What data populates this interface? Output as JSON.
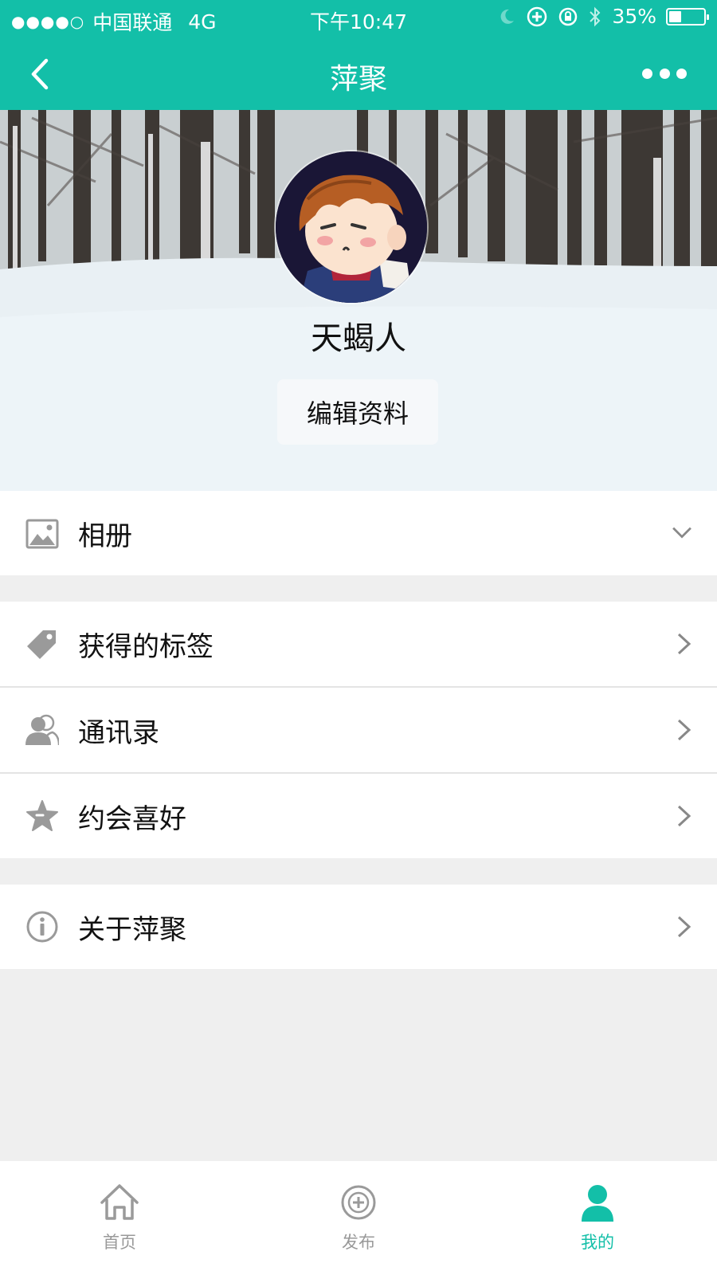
{
  "status_bar": {
    "signal_dots": "●●●●○",
    "carrier": "中国联通",
    "network": "4G",
    "time": "下午10:47",
    "battery_percent": "35%",
    "battery_level": 0.35,
    "icons": [
      "moon-icon",
      "rotation-lock-icon",
      "alarm-icon",
      "bluetooth-icon",
      "battery-icon"
    ]
  },
  "nav": {
    "title": "萍聚",
    "back_icon": "chevron-left-icon",
    "more_icon": "more-dots-icon"
  },
  "profile": {
    "username": "天蝎人",
    "edit_button": "编辑资料",
    "avatar_icon": "cartoon-boy-avatar"
  },
  "menu": {
    "album": {
      "label": "相册",
      "icon": "image-icon",
      "arrow": "chevron-down-icon"
    },
    "tags": {
      "label": "获得的标签",
      "icon": "tag-icon",
      "arrow": "chevron-right-icon"
    },
    "contacts": {
      "label": "通讯录",
      "icon": "contacts-icon",
      "arrow": "chevron-right-icon"
    },
    "dating_prefs": {
      "label": "约会喜好",
      "icon": "star-icon",
      "arrow": "chevron-right-icon"
    },
    "about": {
      "label": "关于萍聚",
      "icon": "info-icon",
      "arrow": "chevron-right-icon"
    }
  },
  "tabbar": {
    "home": {
      "label": "首页",
      "icon": "home-icon"
    },
    "publish": {
      "label": "发布",
      "icon": "publish-plus-icon"
    },
    "mine": {
      "label": "我的",
      "icon": "person-icon",
      "active": true
    }
  },
  "colors": {
    "accent": "#13bfa8",
    "icon_gray": "#9a9a9a",
    "background": "#efefef"
  }
}
